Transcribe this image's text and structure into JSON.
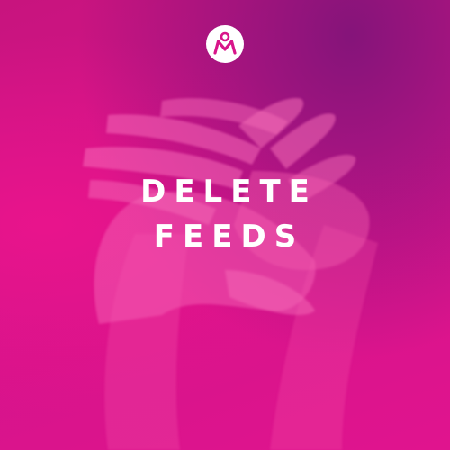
{
  "brand": {
    "logo_icon": "brand-logo-icon",
    "accent_color": "#d8158a",
    "logo_color": "#ffffff"
  },
  "headline": {
    "line1": "DELETE",
    "line2": "FEEDS"
  },
  "background": {
    "image_icon": "hands-photo"
  }
}
